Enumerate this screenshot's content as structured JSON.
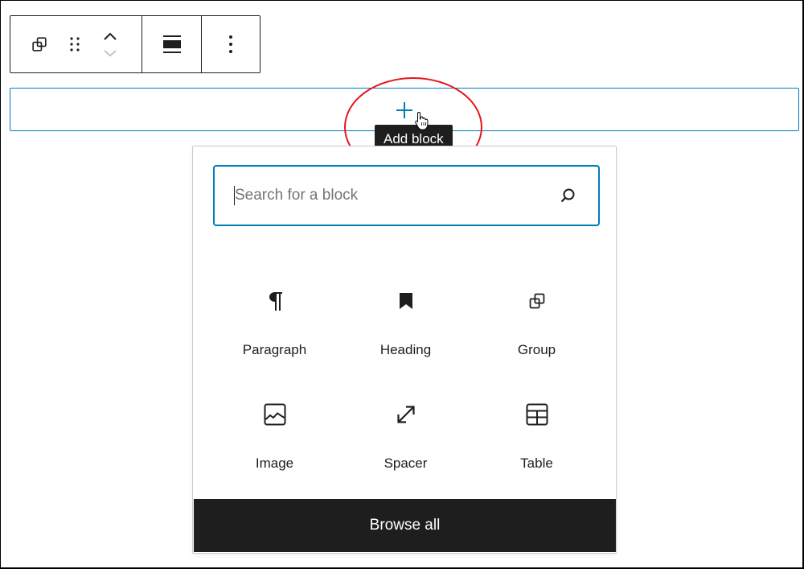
{
  "toolbar": {
    "buttons": [
      {
        "name": "group",
        "icon": "group-icon",
        "label": "Group"
      },
      {
        "name": "drag",
        "icon": "drag-handle-icon",
        "label": "Drag"
      },
      {
        "name": "move-up",
        "icon": "chevron-up-icon",
        "label": "Move up"
      },
      {
        "name": "move-down",
        "icon": "chevron-down-icon",
        "label": "Move down",
        "disabled": true
      },
      {
        "name": "align",
        "icon": "align-wide-icon",
        "label": "Change alignment"
      },
      {
        "name": "options",
        "icon": "more-vertical-icon",
        "label": "Options"
      }
    ]
  },
  "inserter": {
    "button_icon": "plus-icon",
    "tooltip": "Add block",
    "annotation_color": "#e8141b",
    "accent_color": "#007cba"
  },
  "popover": {
    "search": {
      "value": "",
      "placeholder": "Search for a block",
      "icon": "search-icon"
    },
    "blocks": [
      {
        "label": "Paragraph",
        "icon": "paragraph-icon"
      },
      {
        "label": "Heading",
        "icon": "bookmark-icon"
      },
      {
        "label": "Group",
        "icon": "group-icon"
      },
      {
        "label": "Image",
        "icon": "image-icon"
      },
      {
        "label": "Spacer",
        "icon": "resize-arrows-icon"
      },
      {
        "label": "Table",
        "icon": "table-icon"
      }
    ],
    "browse_all": "Browse all"
  }
}
